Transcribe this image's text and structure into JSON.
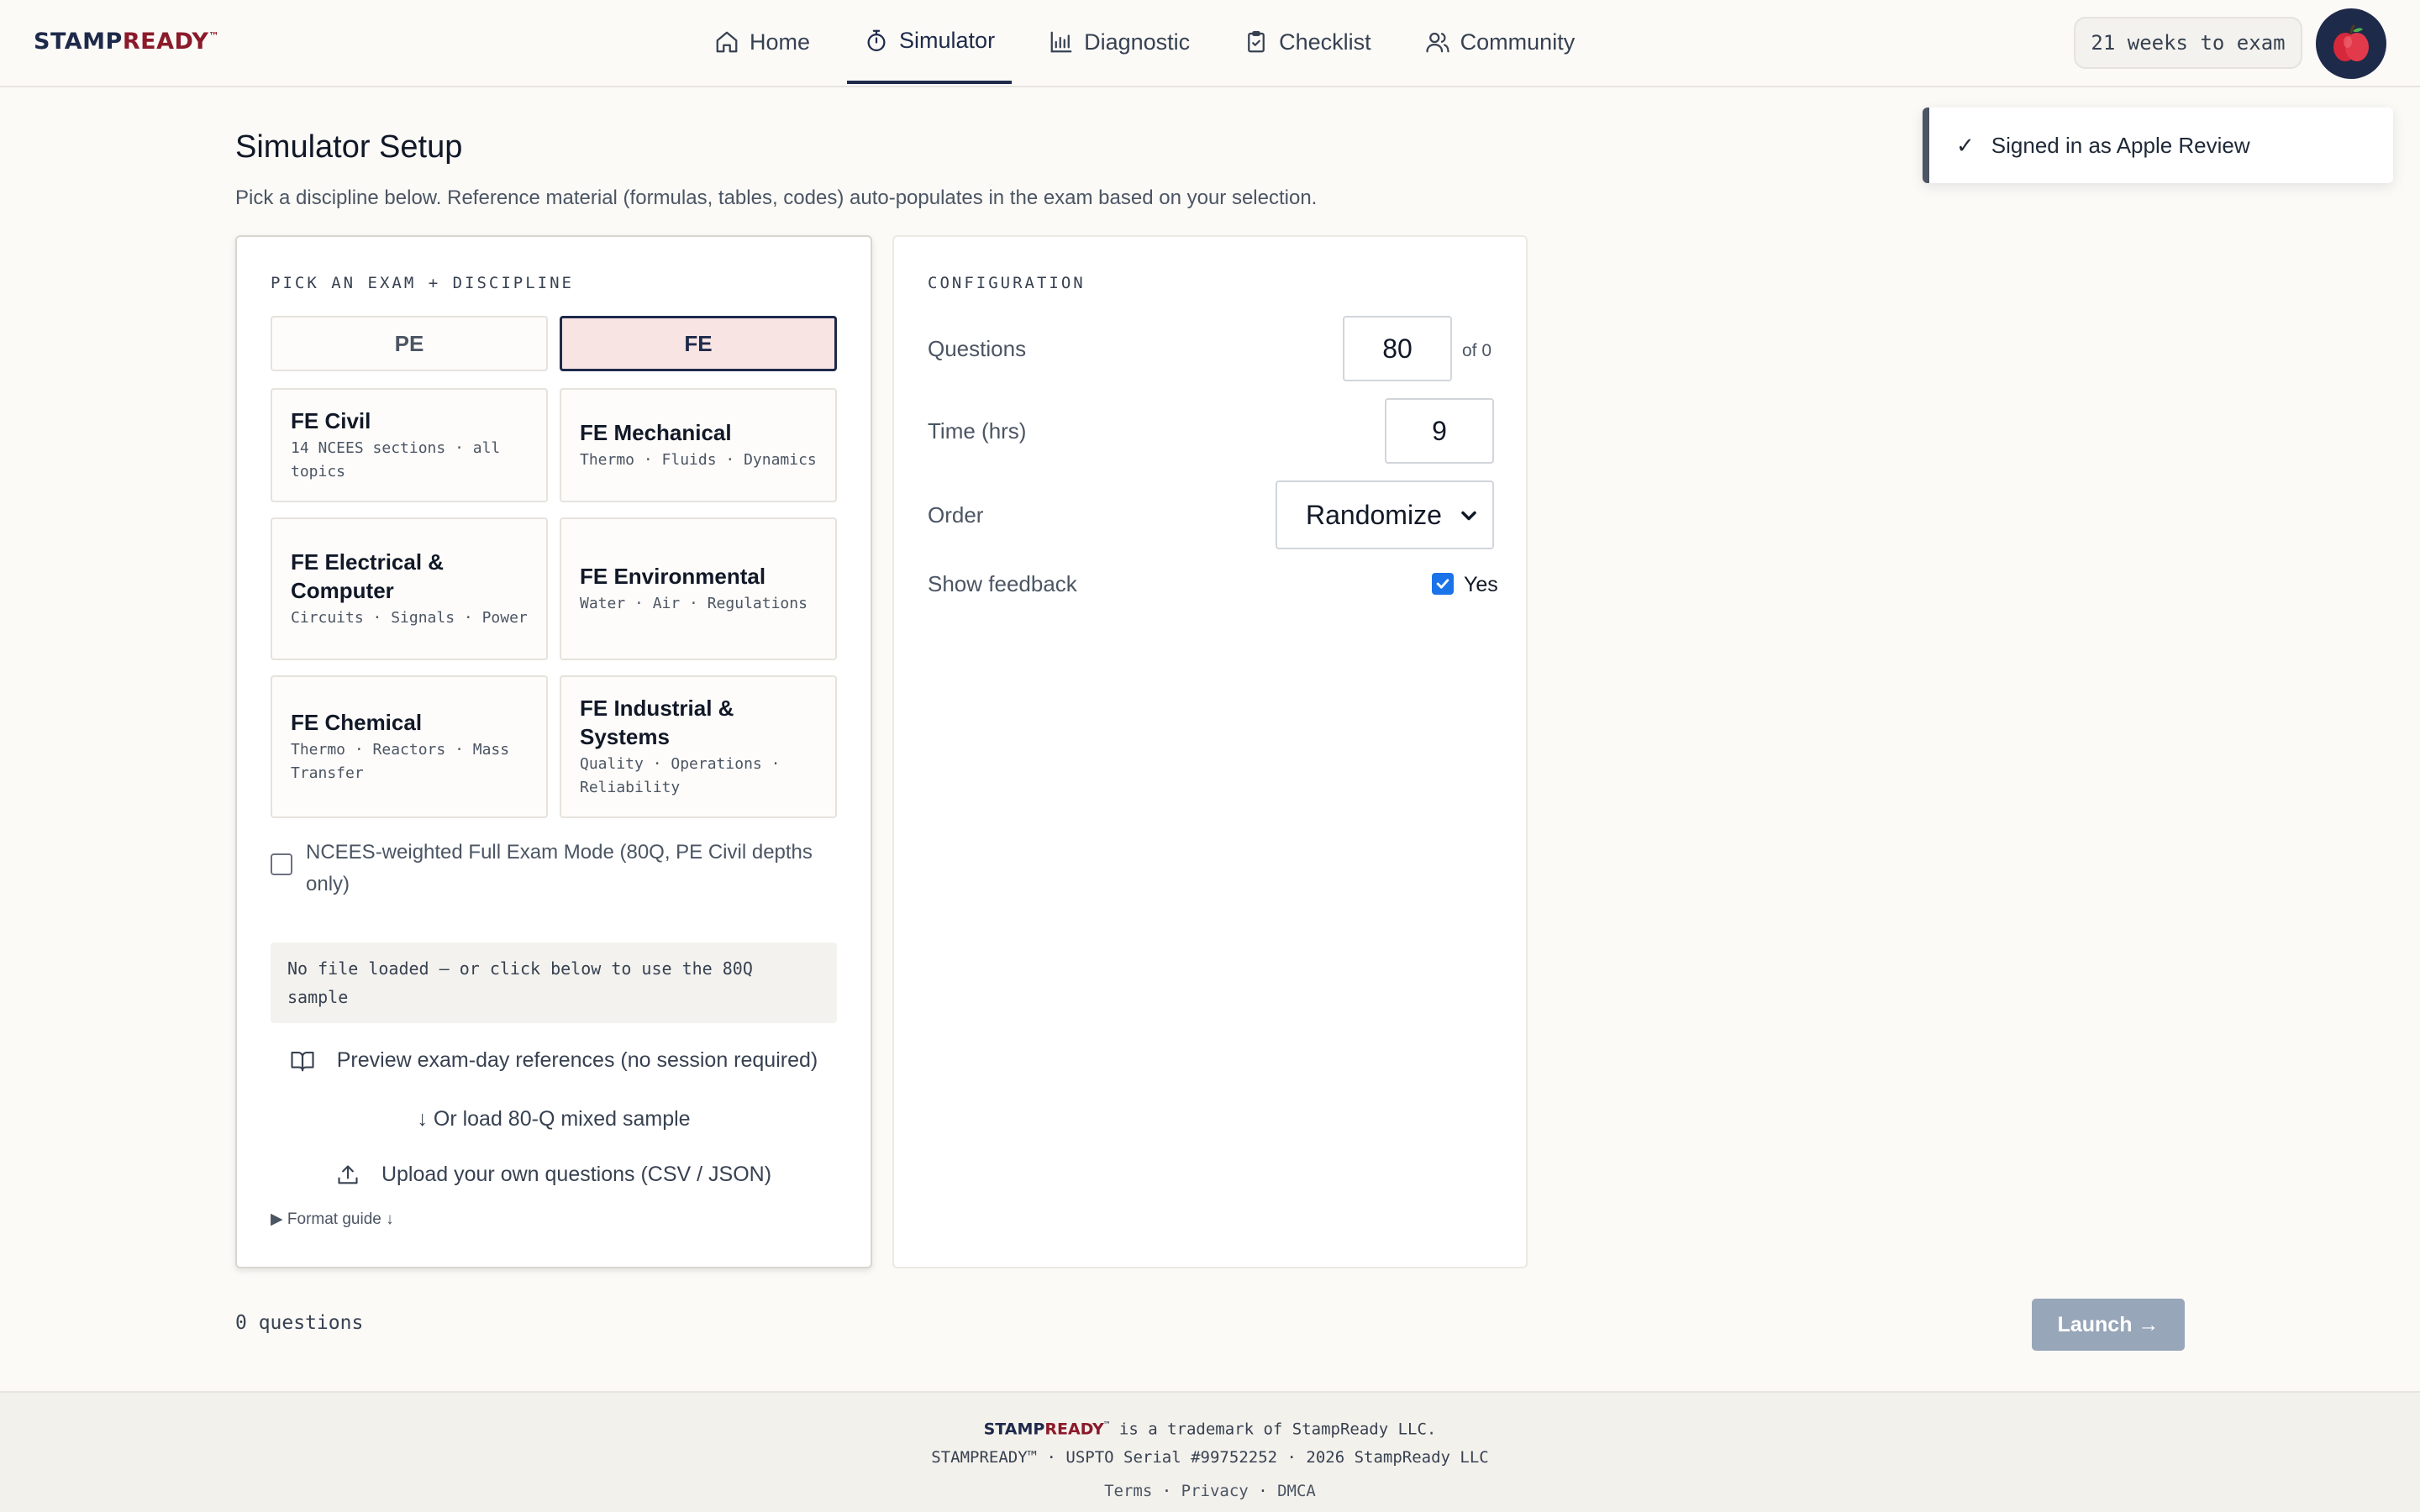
{
  "header": {
    "logo_stamp": "STAMP",
    "logo_ready": "READY",
    "logo_tm": "™",
    "nav": [
      {
        "label": "Home",
        "icon": "home-icon"
      },
      {
        "label": "Simulator",
        "icon": "timer-icon",
        "active": true
      },
      {
        "label": "Diagnostic",
        "icon": "bar-chart-icon"
      },
      {
        "label": "Checklist",
        "icon": "clipboard-check-icon"
      },
      {
        "label": "Community",
        "icon": "users-icon"
      }
    ],
    "weeks_to_exam": "21 weeks to exam",
    "avatar_icon": "apple-icon"
  },
  "toast": {
    "check": "✓",
    "message": "Signed in as Apple Review"
  },
  "page": {
    "title": "Simulator Setup",
    "subtitle": "Pick a discipline below. Reference material (formulas, tables, codes) auto-populates in the exam based on your selection."
  },
  "picker": {
    "label": "PICK AN EXAM + DISCIPLINE",
    "exams": [
      {
        "label": "PE",
        "selected": false
      },
      {
        "label": "FE",
        "selected": true
      }
    ],
    "disciplines": [
      {
        "name": "FE Civil",
        "topics": "14 NCEES sections · all topics"
      },
      {
        "name": "FE Mechanical",
        "topics": "Thermo · Fluids · Dynamics"
      },
      {
        "name": "FE Electrical & Computer",
        "topics": "Circuits · Signals · Power"
      },
      {
        "name": "FE Environmental",
        "topics": "Water · Air · Regulations"
      },
      {
        "name": "FE Chemical",
        "topics": "Thermo · Reactors · Mass Transfer"
      },
      {
        "name": "FE Industrial & Systems",
        "topics": "Quality · Operations · Reliability"
      }
    ],
    "full_exam_mode": "NCEES-weighted Full Exam Mode (80Q, PE Civil depths only)",
    "file_status": "No file loaded — or click below to use the 80Q sample",
    "preview_refs": "Preview exam-day references (no session required)",
    "load_sample": "↓ Or load 80-Q mixed sample",
    "upload": "Upload your own questions (CSV / JSON)",
    "format_guide": "▶ Format guide ↓"
  },
  "config": {
    "label": "CONFIGURATION",
    "questions_label": "Questions",
    "questions_value": "80",
    "questions_of": "of 0",
    "time_label": "Time (hrs)",
    "time_value": "9",
    "order_label": "Order",
    "order_value": "Randomize",
    "feedback_label": "Show feedback",
    "feedback_value": "Yes",
    "feedback_checked": true
  },
  "summary": {
    "question_count": "0 questions",
    "launch_label": "Launch →"
  },
  "footer": {
    "brand_stamp": "STAMP",
    "brand_ready": "READY",
    "brand_tm": "™",
    "trademark_text": " is a trademark of StampReady LLC.",
    "serial": "STAMPREADY™ · USPTO Serial #99752252 · 2026 StampReady LLC",
    "links": [
      "Terms",
      "Privacy",
      "DMCA"
    ],
    "separator": "·"
  },
  "colors": {
    "brand_navy": "#1e2a4a",
    "brand_red": "#8b1a2a",
    "selected_bg": "#f9e4e4",
    "launch_disabled": "#97a6b8",
    "checkbox_blue": "#1a73e8"
  }
}
